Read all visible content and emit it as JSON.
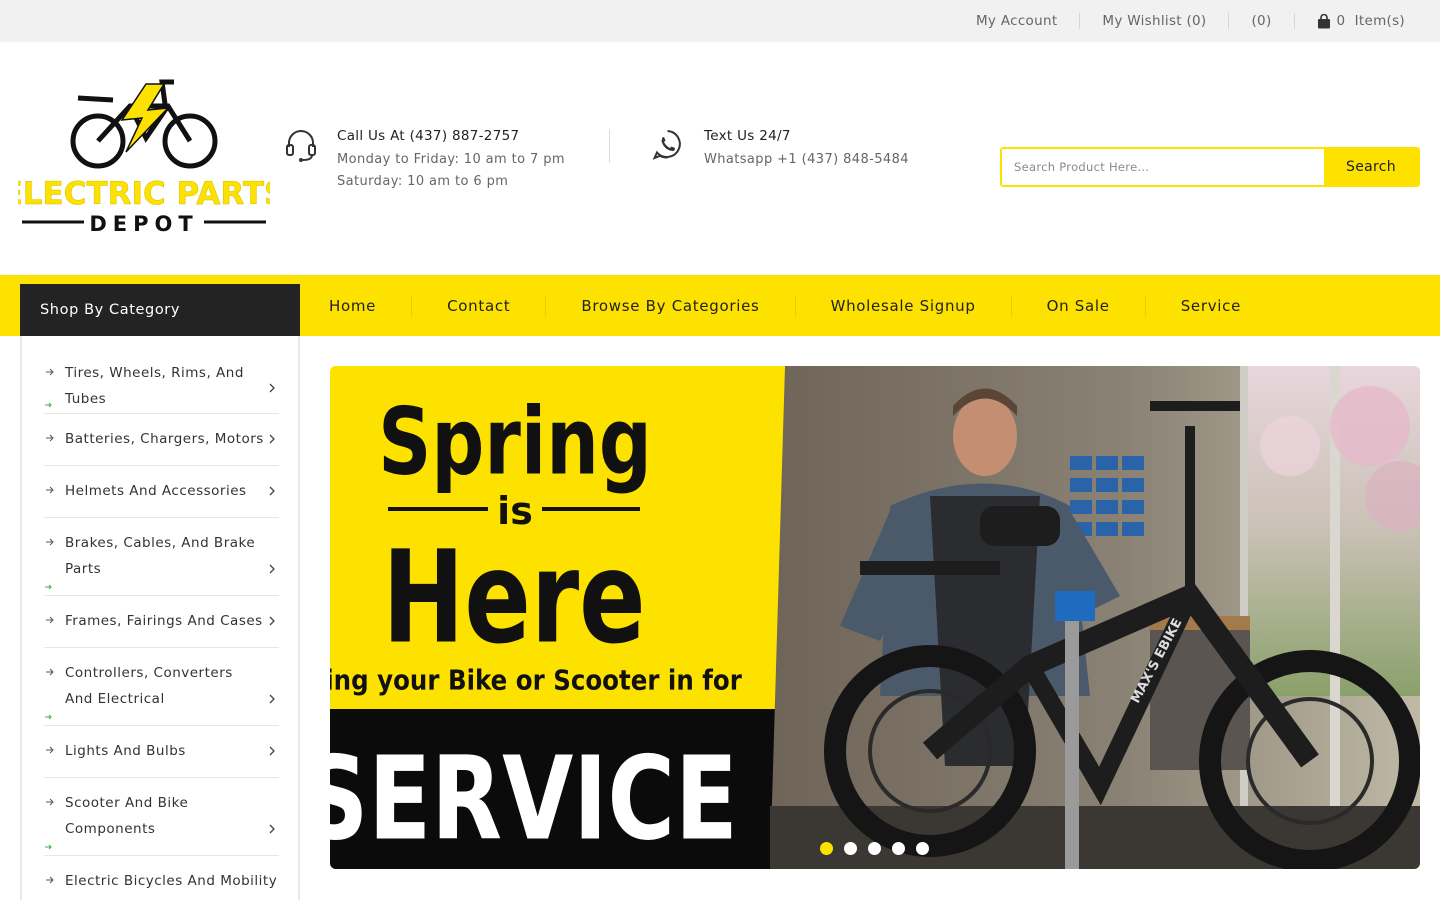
{
  "topbar": {
    "my_account": "My Account",
    "my_wishlist": "My Wishlist (0)",
    "compare": "(0)",
    "cart_count": "0",
    "cart_label": "Item(s)"
  },
  "logo": {
    "line1": "ELECTRIC PARTS",
    "line2": "DEPOT"
  },
  "contact_phone": {
    "title": "Call Us At (437) 887-2757",
    "line1": "Monday to Friday: 10 am to 7 pm",
    "line2": "Saturday: 10 am to 6 pm"
  },
  "contact_text": {
    "title": "Text Us 24/7",
    "line1": "Whatsapp +1 (437) 848-5484"
  },
  "search": {
    "placeholder": "Search Product Here...",
    "button": "Search"
  },
  "shop_by_category": "Shop By Category",
  "menu": [
    "Home",
    "Contact",
    "Browse By Categories",
    "Wholesale Signup",
    "On Sale",
    "Service"
  ],
  "categories": [
    "Tires, Wheels, Rims, And Tubes",
    "Batteries, Chargers, Motors",
    "Helmets And Accessories",
    "Brakes, Cables, And Brake Parts",
    "Frames, Fairings And Cases",
    "Controllers, Converters And Electrical",
    "Lights And Bulbs",
    "Scooter And Bike Components",
    "Electric Bicycles And Mobility"
  ],
  "banner": {
    "line_spring": "Spring",
    "line_is": "is",
    "line_here": "Here",
    "line_bring": "Bring your Bike or Scooter in for",
    "line_service": "SERVICE",
    "bike_brand": "MAX'S EBIKE",
    "slide_count": 5,
    "active_slide": 1
  },
  "colors": {
    "accent": "#fde200",
    "dark": "#232323",
    "topbar_bg": "#f1f1f1"
  }
}
